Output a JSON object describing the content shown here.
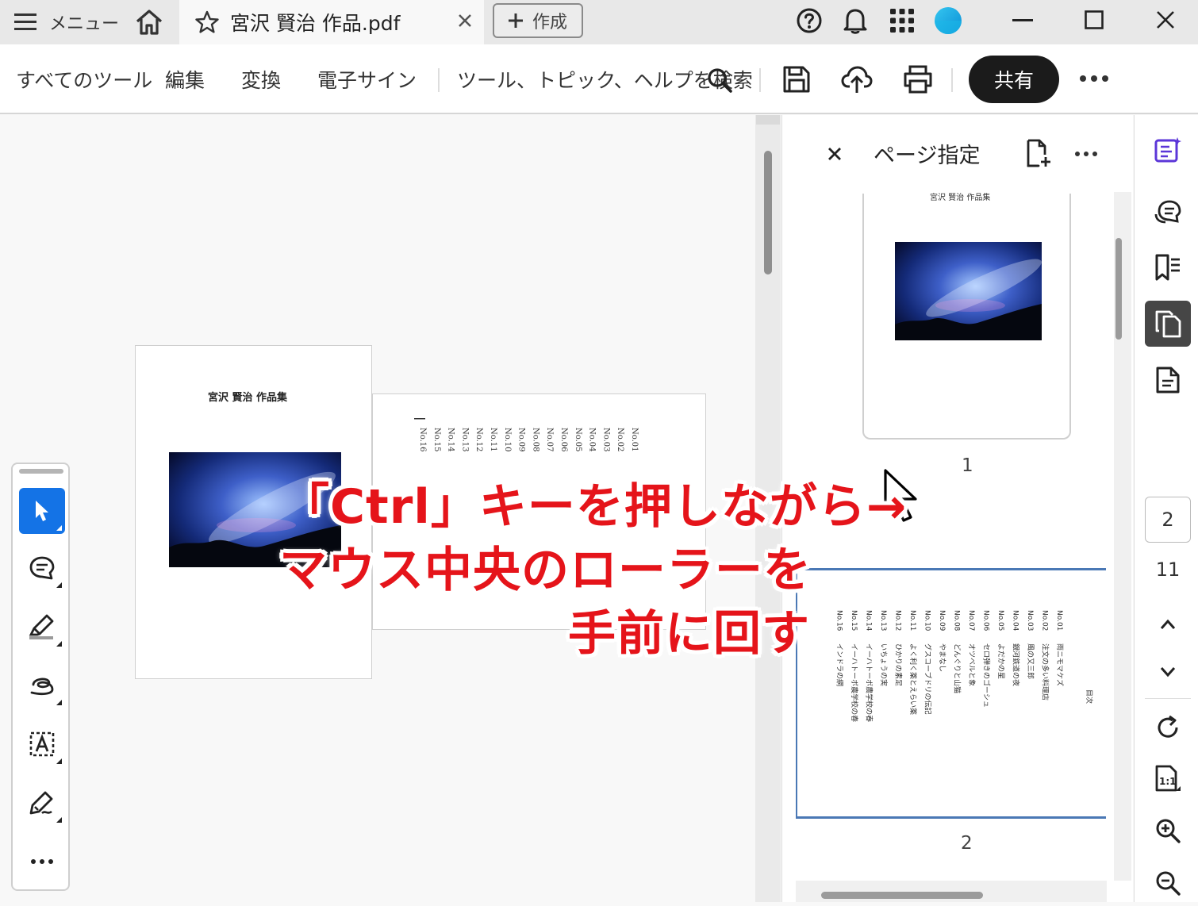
{
  "window": {
    "menu_label": "メニュー",
    "tab_title": "宮沢 賢治 作品.pdf",
    "create_label": "作成"
  },
  "toolbar": {
    "tabs": [
      "すべてのツール",
      "編集",
      "変換",
      "電子サイン"
    ],
    "search_label": "ツール、トピック、ヘルプを検索",
    "share_label": "共有"
  },
  "document": {
    "page1_title": "宮沢 賢治 作品集",
    "toc_entries": [
      "No.01",
      "No.02",
      "No.03",
      "No.04",
      "No.05",
      "No.06",
      "No.07",
      "No.08",
      "No.09",
      "No.10",
      "No.11",
      "No.12",
      "No.13",
      "No.14",
      "No.15",
      "No.16"
    ]
  },
  "panel": {
    "title": "ページ指定",
    "thumb1_caption": "宮沢 賢治 作品集",
    "thumb2_heading": "目次",
    "thumb2_lines": [
      "雨ニモマケズ",
      "注文の多い料理店",
      "風の又三郎",
      "銀河鉄道の夜",
      "よだかの星",
      "セロ弾きのゴーシュ",
      "オツベルと象",
      "どんぐりと山猫",
      "やまなし",
      "グスコーブドリの伝記",
      "よく利く薬とえらい薬",
      "ひかりの素足",
      "いちょうの実",
      "イーハトーボ農学校の春",
      "イーハトーボ農学校の春",
      "インドラの網"
    ],
    "page_labels": [
      "1",
      "2"
    ]
  },
  "rail": {
    "current_page": "2",
    "total_pages": "11"
  },
  "annotation": {
    "line1": "「Ctrl」キーを押しながら→",
    "line2": "マウス中央のローラーを",
    "line3": "手前に回す"
  },
  "colors": {
    "accent_blue": "#1473e6",
    "annotation_red": "#e5141a",
    "share_bg": "#1b1b1b"
  }
}
